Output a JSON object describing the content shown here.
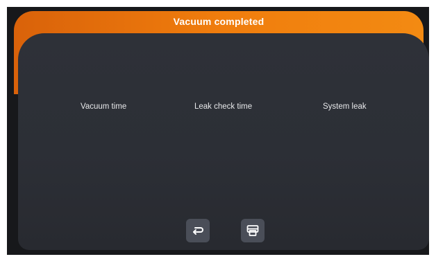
{
  "dialog": {
    "title": "Vacuum completed"
  },
  "metrics": {
    "vacuum_time_label": "Vacuum time",
    "leak_check_time_label": "Leak check time",
    "system_leak_label": "System leak"
  },
  "buttons": {
    "back_icon": "return-arrow-icon",
    "print_icon": "printer-icon"
  },
  "colors": {
    "header_orange": "#f07d0d",
    "panel_bg": "#2e3138",
    "screen_bg": "#17181b",
    "button_bg": "#4a4e58"
  }
}
